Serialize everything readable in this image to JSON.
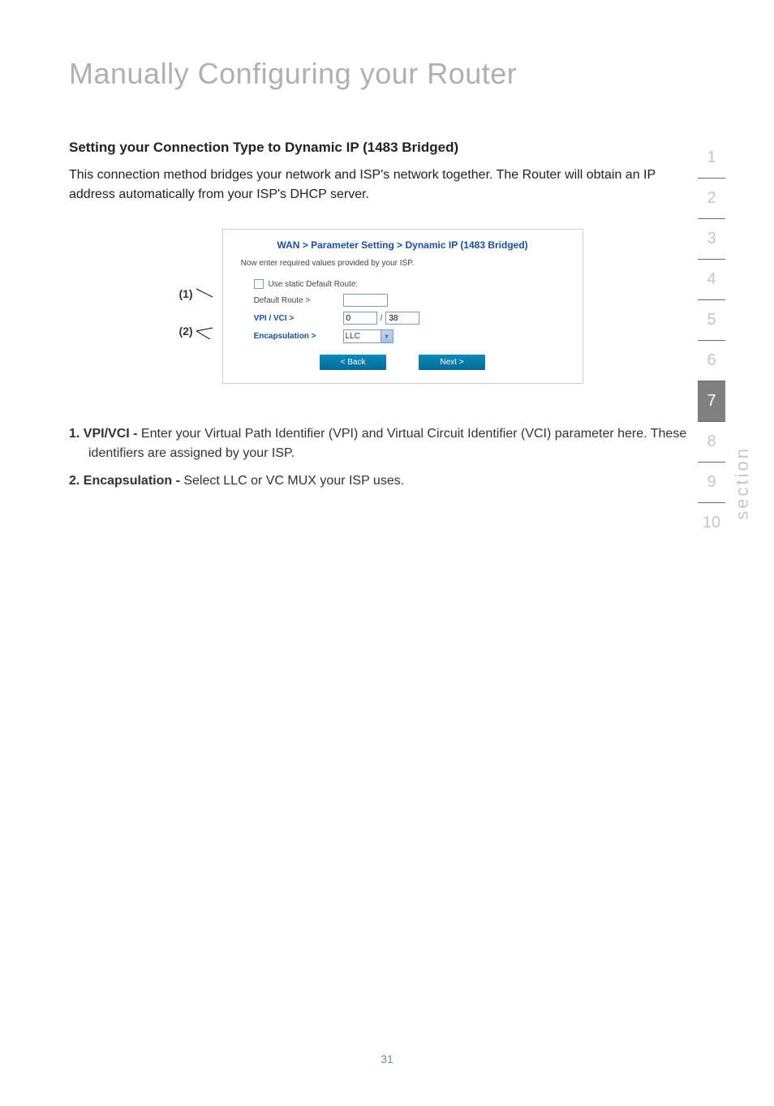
{
  "page_title": "Manually Configuring your Router",
  "section_heading": "Setting your Connection Type to Dynamic IP (1483 Bridged)",
  "intro_text": "This connection method bridges your network and ISP's network together. The Router will obtain an IP address automatically from your ISP's DHCP server.",
  "callouts": {
    "c1": "(1)",
    "c2": "(2)"
  },
  "screenshot": {
    "title": "WAN > Parameter Setting > Dynamic IP (1483 Bridged)",
    "subtitle": "Now enter required values provided by your ISP.",
    "static_route_label": "Use static Default Route:",
    "default_route_label": "Default Route >",
    "vpi_vci_label": "VPI / VCI >",
    "vpi_value": "0",
    "vci_value": "38",
    "slash": "/",
    "encapsulation_label": "Encapsulation >",
    "encapsulation_value": "LLC",
    "back_btn": "< Back",
    "next_btn": "Next >"
  },
  "list": {
    "item1_label": "1. VPI/VCI - ",
    "item1_text": "Enter your Virtual Path Identifier (VPI) and Virtual Circuit Identifier (VCI) parameter here. These identifiers are assigned by your ISP.",
    "item2_label": "2. Encapsulation - ",
    "item2_text": "Select LLC or VC MUX your ISP uses."
  },
  "nav": {
    "n1": "1",
    "n2": "2",
    "n3": "3",
    "n4": "4",
    "n5": "5",
    "n6": "6",
    "n7": "7",
    "n8": "8",
    "n9": "9",
    "n10": "10"
  },
  "section_label": "section",
  "page_number": "31",
  "chart_data": {
    "type": "table",
    "title": "WAN Parameter Setting - Dynamic IP (1483 Bridged)",
    "fields": [
      {
        "label": "Use static Default Route",
        "type": "checkbox",
        "value": false
      },
      {
        "label": "Default Route",
        "type": "text",
        "value": ""
      },
      {
        "label": "VPI",
        "type": "number",
        "value": 0
      },
      {
        "label": "VCI",
        "type": "number",
        "value": 38
      },
      {
        "label": "Encapsulation",
        "type": "select",
        "value": "LLC",
        "options": [
          "LLC",
          "VC MUX"
        ]
      }
    ]
  }
}
